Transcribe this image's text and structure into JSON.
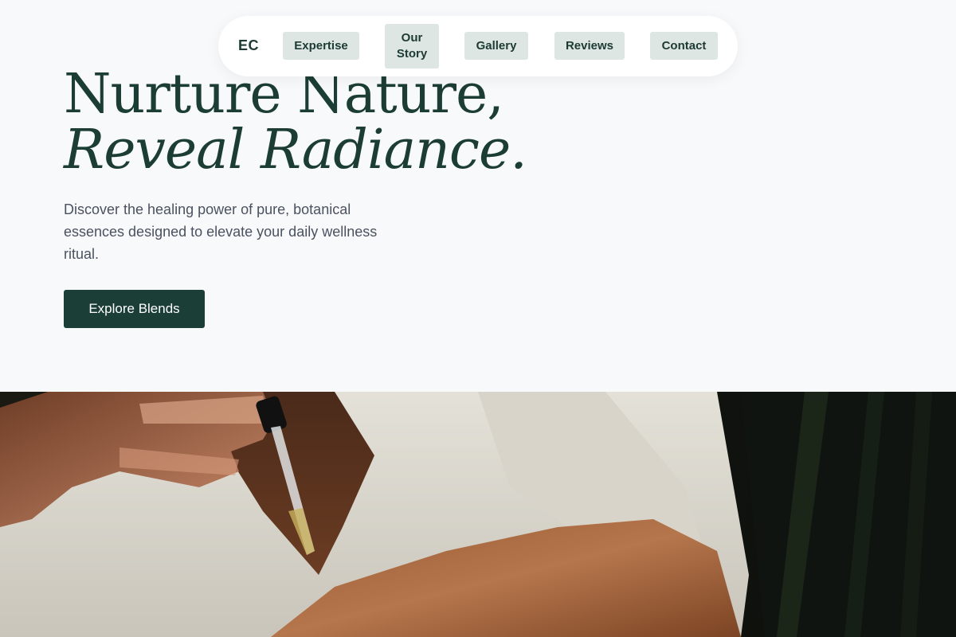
{
  "nav": {
    "logo": "EC",
    "items": [
      {
        "label": "Expertise"
      },
      {
        "label": "Our Story"
      },
      {
        "label": "Gallery"
      },
      {
        "label": "Reviews"
      },
      {
        "label": "Contact"
      }
    ]
  },
  "hero": {
    "headline_line1": "Nurture Nature,",
    "headline_line2": "Reveal Radiance.",
    "subtitle": "Discover the healing power of pure, botanical essences designed to elevate your daily wellness ritual.",
    "cta_label": "Explore Blends"
  },
  "colors": {
    "brand_dark_green": "#1b3e36",
    "nav_button_bg": "#dde6e2",
    "page_bg": "#f8f9fb",
    "body_text": "#4a5260"
  },
  "icons": {
    "photo": "person-applying-dropper-oil-image"
  }
}
